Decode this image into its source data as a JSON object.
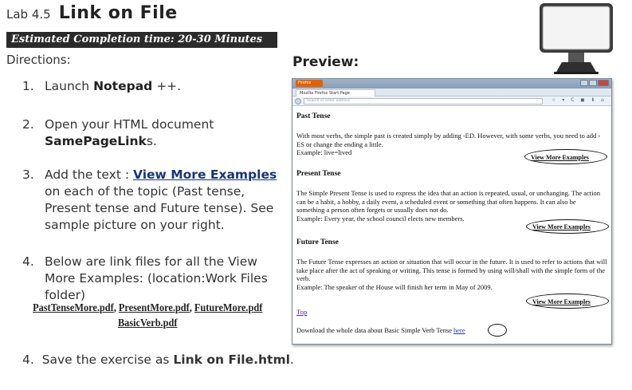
{
  "lab": {
    "number": "Lab 4.5",
    "title": "Link on File"
  },
  "estimated_time": "Estimated Completion time:  20-30 Minutes",
  "directions_label": "Directions:",
  "steps": [
    {
      "num": "1.",
      "pre": "Launch ",
      "bold": "Notepad",
      "post": " ++."
    },
    {
      "num": "2.",
      "pre": "Open your HTML document ",
      "bold": "SamePageLink",
      "post": "s."
    },
    {
      "num": "3.",
      "pre": "Add the text : ",
      "link": "View More Examples",
      "post": " on each of the topic (Past tense, Present tense and Future tense). See sample picture on your right."
    },
    {
      "num": "4.",
      "text": "Below are link files for all the View More Examples: (location:Work Files folder)"
    }
  ],
  "link_files": {
    "file1": "PastTenseMore.pdf",
    "file2": "PresentMore.pdf",
    "file3": "FutureMore.pdf",
    "file4": "BasicVerb.pdf",
    "sep": ", "
  },
  "save_step": {
    "num": "4.",
    "pre": "Save the exercise as ",
    "bold": "Link on File.html",
    "post": "."
  },
  "preview_label": "Preview:",
  "browser": {
    "app_button": "Firefox",
    "tab_label": "Mozilla Firefox Start Page",
    "url_placeholder": "Search or enter address",
    "nav_icons": "☆ ▾ C ◼ ⬇ ⌂",
    "past_heading": "Past Tense",
    "past_text": "With most verbs, the simple past is created simply by adding -ED. However, with some verbs, you need to add -ES or change the ending a little.",
    "past_example": "Example: live=lived",
    "present_heading": "Present Tense",
    "present_text": "The Simple Present Tense is used to express the idea that an action is repeated, usual, or unchanging. The action can be a habit, a hobby, a daily event, a scheduled event or something that often happens. It can also be something a person often forgets or usually does not do.",
    "present_example": "Example: Every year, the school council elects new members.",
    "future_heading": "Future Tense",
    "future_text": "The Future Tense expresses an action or situation that will occur in the future. It is used to refer to actions that will take place after the act of speaking or writing. This tense is formed by using will/shall with the simple form of the verb.",
    "future_example": "Example: The speaker of the House will finish her term in May of 2009.",
    "more_link": "View More Examples",
    "top_link": "Top",
    "download_text": "Download the whole data about Basic Simple Verb Tense",
    "here_link": "here"
  }
}
